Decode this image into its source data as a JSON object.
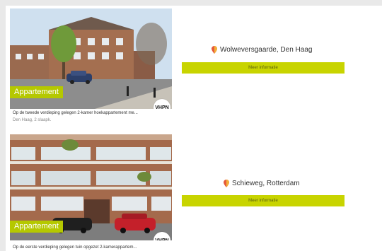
{
  "listings": [
    {
      "type_badge": "Appartement",
      "logo_text": "VHPN",
      "description": "Op de tweede verdieping gelegen 2-kamer hoekappartement me...",
      "location_small": "Den Haag, 2 slaapk.",
      "title": "Wolweversgaarde, Den Haag",
      "button_label": "Meer informatie",
      "icon": "location-pin-icon"
    },
    {
      "type_badge": "Appartement",
      "logo_text": "VHPN",
      "description": "Op de eerste verdieping gelegen tuin opgezet 2-kamerappartem...",
      "title": "Schieweg, Rotterdam",
      "button_label": "Meer informatie",
      "icon": "location-pin-icon"
    }
  ],
  "colors": {
    "accent": "#c8d400",
    "badge": "#b5c800",
    "frame": "#e9e9e9"
  }
}
